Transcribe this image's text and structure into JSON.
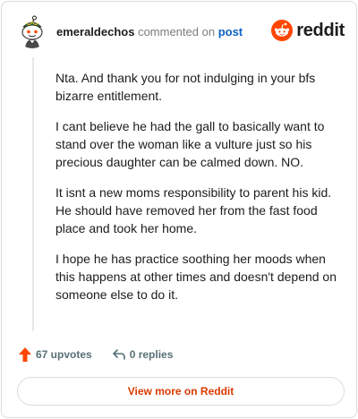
{
  "header": {
    "username": "emeraldechos",
    "action_text": "commented on",
    "post_link": "post",
    "avatar_icon": "snoo-avatar-icon",
    "brand_icon": "reddit-logo-icon",
    "brand_wordmark": "reddit"
  },
  "comment": {
    "paragraphs": [
      "Nta. And thank you for not indulging in your bfs bizarre entitlement.",
      "I cant believe he had the gall to basically want to stand over the woman like a vulture just so his precious daughter can be calmed down. NO.",
      "It isnt a new moms responsibility to parent his kid. He should have removed her from the fast food place and took her home.",
      "I hope he has practice soothing her moods when this happens at other times and doesn't depend on someone else to do it."
    ]
  },
  "actions": {
    "upvotes_icon": "upvote-arrow-icon",
    "upvotes_label": "67 upvotes",
    "replies_icon": "reply-arrow-icon",
    "replies_label": "0 replies"
  },
  "footer": {
    "view_more_label": "View more on Reddit"
  },
  "colors": {
    "accent": "#d93a00",
    "brand": "#ff4500",
    "link": "#0b62c4",
    "muted": "#576f76",
    "border": "#d9dcde"
  }
}
